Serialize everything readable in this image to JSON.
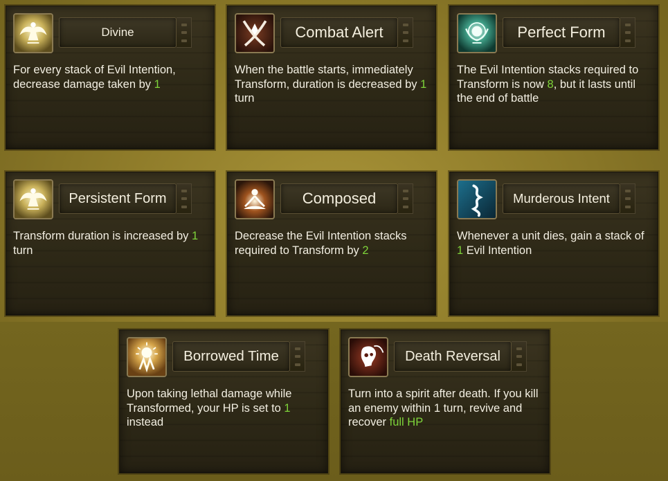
{
  "cards": [
    {
      "title": "Divine",
      "icon": "winged-figure-icon",
      "desc": [
        {
          "t": "For every stack of Evil Intention, decrease damage taken by "
        },
        {
          "t": "1",
          "hl": true
        }
      ]
    },
    {
      "title": "Combat Alert",
      "icon": "crossed-swords-icon",
      "desc": [
        {
          "t": "When the battle starts, immediately Transform, duration is decreased by "
        },
        {
          "t": "1",
          "hl": true
        },
        {
          "t": " turn"
        }
      ]
    },
    {
      "title": "Perfect Form",
      "icon": "radiant-orb-icon",
      "desc": [
        {
          "t": "The Evil Intention stacks required to Transform is now "
        },
        {
          "t": "8",
          "hl": true
        },
        {
          "t": ", but it lasts until the end of battle"
        }
      ]
    },
    {
      "title": "Persistent Form",
      "icon": "winged-figure-icon",
      "desc": [
        {
          "t": "Transform duration is increased by "
        },
        {
          "t": "1",
          "hl": true
        },
        {
          "t": " turn"
        }
      ]
    },
    {
      "title": "Composed",
      "icon": "meditating-figure-icon",
      "desc": [
        {
          "t": "Decrease the Evil Intention stacks required to Transform by "
        },
        {
          "t": "2",
          "hl": true
        }
      ]
    },
    {
      "title": "Murderous Intent",
      "icon": "spiral-blade-icon",
      "desc": [
        {
          "t": "Whenever a unit dies, gain a stack of "
        },
        {
          "t": "1",
          "hl": true
        },
        {
          "t": " Evil Intention"
        }
      ]
    },
    {
      "title": "Borrowed Time",
      "icon": "sunburst-icon",
      "desc": [
        {
          "t": "Upon taking lethal damage while Transformed, your HP is set to "
        },
        {
          "t": "1",
          "hl": true
        },
        {
          "t": " instead"
        }
      ]
    },
    {
      "title": "Death Reversal",
      "icon": "spirit-skull-icon",
      "desc": [
        {
          "t": "Turn into a spirit after death. If you kill an enemy within 1 turn, revive and recover "
        },
        {
          "t": " full HP",
          "hl": true
        }
      ]
    }
  ],
  "colors": {
    "highlight": "#7ed43a",
    "text": "#f3efe2",
    "panel": "#2e2917",
    "background": "#8f7c2a"
  }
}
